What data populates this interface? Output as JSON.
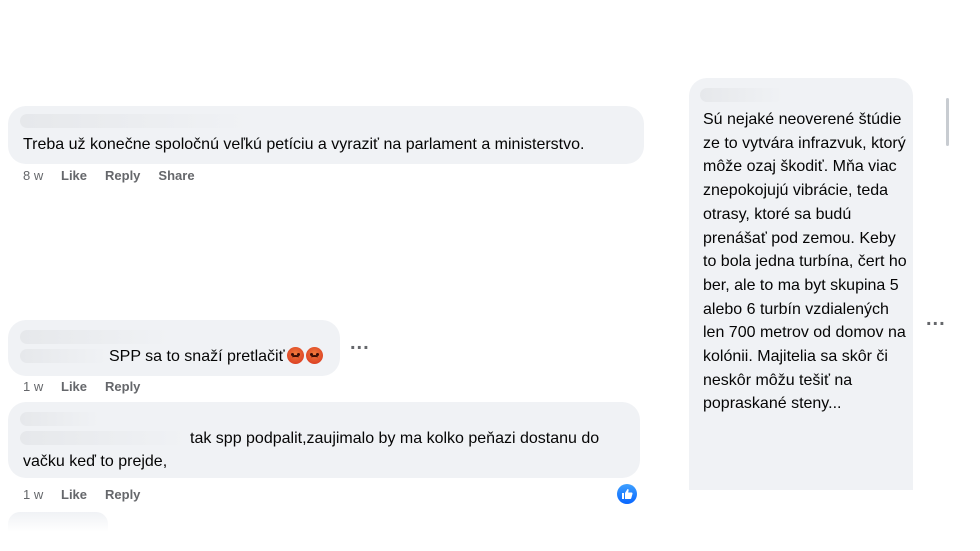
{
  "comments": [
    {
      "text": "Treba už konečne spoločnú veľkú petíciu a vyraziť na parlament a ministerstvo.",
      "age": "8 w",
      "like": "Like",
      "reply": "Reply",
      "share": "Share"
    },
    {
      "text": "SPP sa to snaží pretlačiť",
      "age": "1 w",
      "like": "Like",
      "reply": "Reply",
      "more": "..."
    },
    {
      "text_line1": "tak spp podpalit,zaujimalo by ma kolko peňazi dostanu do",
      "text_line2": "vačku keď to prejde,",
      "age": "1 w",
      "like": "Like",
      "reply": "Reply"
    }
  ],
  "right_comment": {
    "text": "Sú nejaké neoverené štúdie ze to vytvára infrazvuk, ktorý môže ozaj škodiť. Mňa viac znepokojujú vibrácie, teda otrasy, ktoré sa budú prenášať pod zemou. Keby to bola jedna turbína, čert ho ber, ale to ma byt skupina 5 alebo 6 turbín vzdialených len 700 metrov od domov na kolónii. Majitelia sa skôr či neskôr môžu tešiť na popraskané steny...",
    "more": "..."
  },
  "icons": {
    "reaction": "angry-face-icon",
    "like_badge": "like-icon"
  },
  "colors": {
    "bubble": "#f0f2f5",
    "meta": "#65676b",
    "like_blue": "#0866ff"
  }
}
